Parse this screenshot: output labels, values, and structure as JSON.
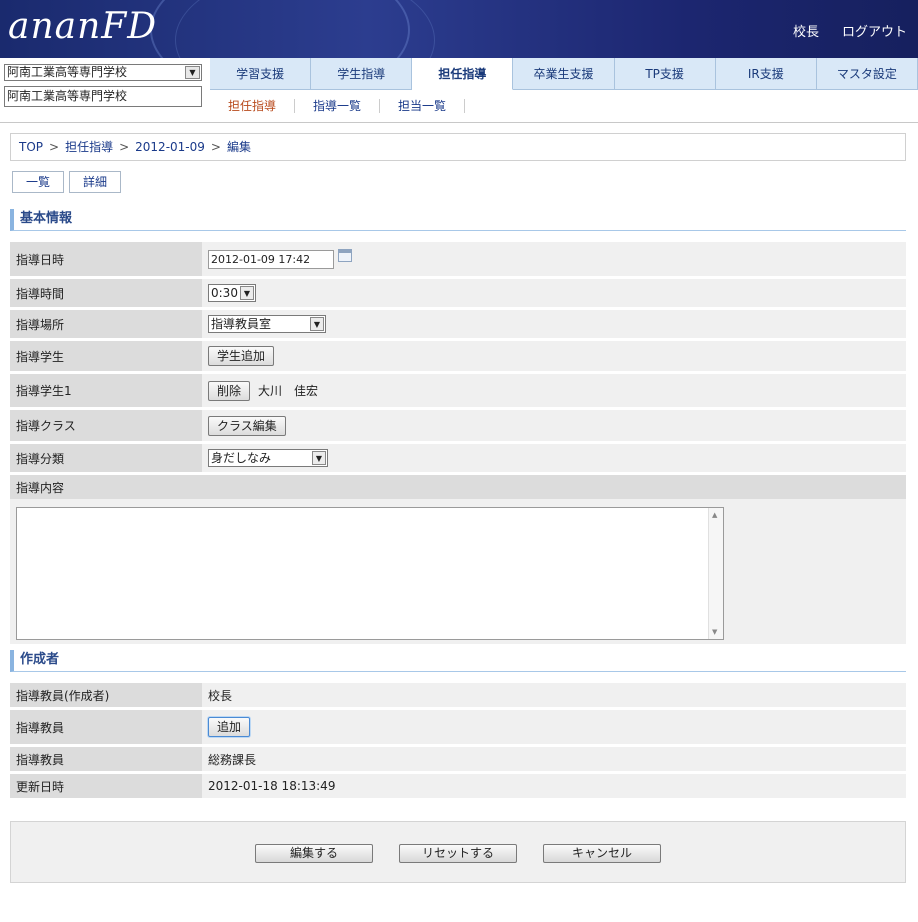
{
  "header": {
    "logo": "ananFD",
    "user": "校長",
    "logout": "ログアウト"
  },
  "school": {
    "selected": "阿南工業高等専門学校",
    "display": "阿南工業高等専門学校"
  },
  "tabs": [
    {
      "label": "学習支援"
    },
    {
      "label": "学生指導"
    },
    {
      "label": "担任指導"
    },
    {
      "label": "卒業生支援"
    },
    {
      "label": "TP支援"
    },
    {
      "label": "IR支援"
    },
    {
      "label": "マスタ設定"
    }
  ],
  "subnav": [
    {
      "label": "担任指導"
    },
    {
      "label": "指導一覧"
    },
    {
      "label": "担当一覧"
    }
  ],
  "breadcrumb": [
    "TOP",
    "担任指導",
    "2012-01-09",
    "編集"
  ],
  "breadcrumb_sep": ">",
  "top_buttons": {
    "list": "一覧",
    "detail": "詳細"
  },
  "basic": {
    "section_title": "基本情報",
    "datetime_label": "指導日時",
    "datetime_value": "2012-01-09 17:42",
    "duration_label": "指導時間",
    "duration_value": "0:30",
    "place_label": "指導場所",
    "place_value": "指導教員室",
    "student_label": "指導学生",
    "add_student_btn": "学生追加",
    "student1_label": "指導学生1",
    "delete_btn": "削除",
    "student1_name": "大川　佳宏",
    "class_label": "指導クラス",
    "class_edit_btn": "クラス編集",
    "category_label": "指導分類",
    "category_value": "身だしなみ",
    "content_label": "指導内容",
    "content_value": ""
  },
  "creator": {
    "section_title": "作成者",
    "author_label": "指導教員(作成者)",
    "author_value": "校長",
    "teacher_label": "指導教員",
    "add_btn": "追加",
    "teacher2_label": "指導教員",
    "teacher2_value": "総務課長",
    "updated_label": "更新日時",
    "updated_value": "2012-01-18 18:13:49"
  },
  "actions": {
    "save": "編集する",
    "reset": "リセットする",
    "cancel": "キャンセル"
  },
  "icons": {
    "select_arrow": "chevron-down-icon",
    "calendar": "calendar-icon"
  },
  "colors": {
    "header_bg": "#1c2a70",
    "tab_bg": "#d9e8f7",
    "accent": "#8ab4e0",
    "active_subnav": "#b84a1c"
  }
}
